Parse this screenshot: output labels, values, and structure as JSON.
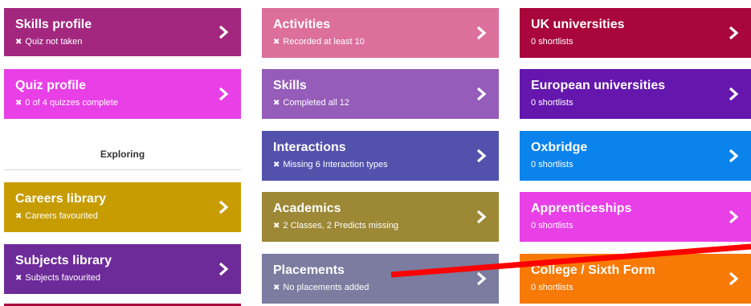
{
  "tiles": {
    "skills_profile": {
      "title": "Skills profile",
      "status": "Quiz not taken",
      "color": "#a3277f"
    },
    "quiz_profile": {
      "title": "Quiz profile",
      "status": "0 of 4 quizzes complete",
      "color": "#e83fe6"
    },
    "careers_library": {
      "title": "Careers library",
      "status": "Careers favourited",
      "color": "#c79c00"
    },
    "subjects_library": {
      "title": "Subjects library",
      "status": "Subjects favourited",
      "color": "#6d2a99"
    },
    "activities": {
      "title": "Activities",
      "status": "Recorded at least 10",
      "color": "#dc6f9c"
    },
    "skills": {
      "title": "Skills",
      "status": "Completed all 12",
      "color": "#955cb9"
    },
    "interactions": {
      "title": "Interactions",
      "status": "Missing 6 Interaction types",
      "color": "#5252ad"
    },
    "academics": {
      "title": "Academics",
      "status": "2 Classes, 2 Predicts missing",
      "color": "#9c8835"
    },
    "placements": {
      "title": "Placements",
      "status": "No placements added",
      "color": "#7b7c9f"
    },
    "uk_universities": {
      "title": "UK universities",
      "status": "0 shortlists",
      "color": "#a8063c"
    },
    "european_universities": {
      "title": "European universities",
      "status": "0 shortlists",
      "color": "#6416ad"
    },
    "oxbridge": {
      "title": "Oxbridge",
      "status": "0 shortlists",
      "color": "#0b83ec"
    },
    "apprenticeships": {
      "title": "Apprenticeships",
      "status": "0 shortlists",
      "color": "#e83fe6"
    },
    "college_sixth_form": {
      "title": "College / Sixth Form",
      "status": "0 shortlists",
      "color": "#f77a07"
    }
  },
  "section_label": "Exploring",
  "bottom_strip_color": "#a8063c",
  "annotation_color": "#ff0000",
  "icons": {
    "status": "close-icon",
    "navigate": "chevron-right-icon"
  }
}
